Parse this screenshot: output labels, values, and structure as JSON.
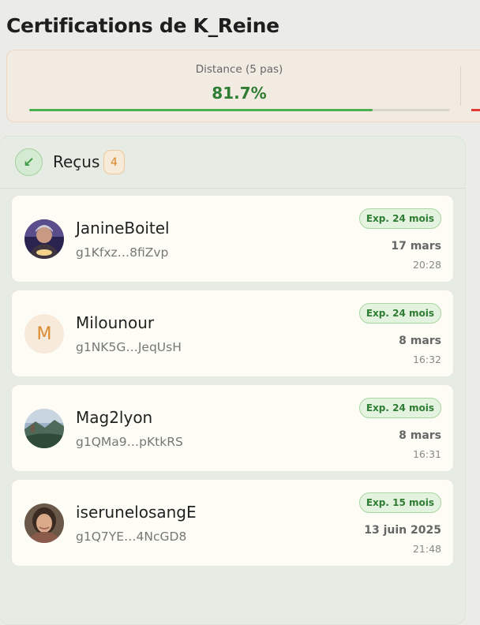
{
  "page_title": "Certifications de K_Reine",
  "stats": {
    "distance_label": "Distance (5 pas)",
    "distance_value": "81.7%",
    "distance_fraction": 0.817
  },
  "received": {
    "title": "Reçus",
    "count": "4",
    "icon": "arrow-down-left-icon",
    "items": [
      {
        "name": "JanineBoitel",
        "key": "g1Kfxz…8fiZvp",
        "exp": "Exp. 24 mois",
        "date": "17 mars",
        "time": "20:28",
        "avatar": "photo"
      },
      {
        "name": "Milounour",
        "key": "g1NK5G…JeqUsH",
        "exp": "Exp. 24 mois",
        "date": "8 mars",
        "time": "16:32",
        "avatar": "letter",
        "avatar_letter": "M"
      },
      {
        "name": "Mag2lyon",
        "key": "g1QMa9…pKtkRS",
        "exp": "Exp. 24 mois",
        "date": "8 mars",
        "time": "16:31",
        "avatar": "photo"
      },
      {
        "name": "iserunelosangE",
        "key": "g1Q7YE…4NcGD8",
        "exp": "Exp. 15 mois",
        "date": "13 juin 2025",
        "time": "21:48",
        "avatar": "photo"
      }
    ]
  },
  "colors": {
    "accent_green": "#4caf50",
    "badge_orange": "#d98424",
    "red_indicator": "#e53935"
  }
}
